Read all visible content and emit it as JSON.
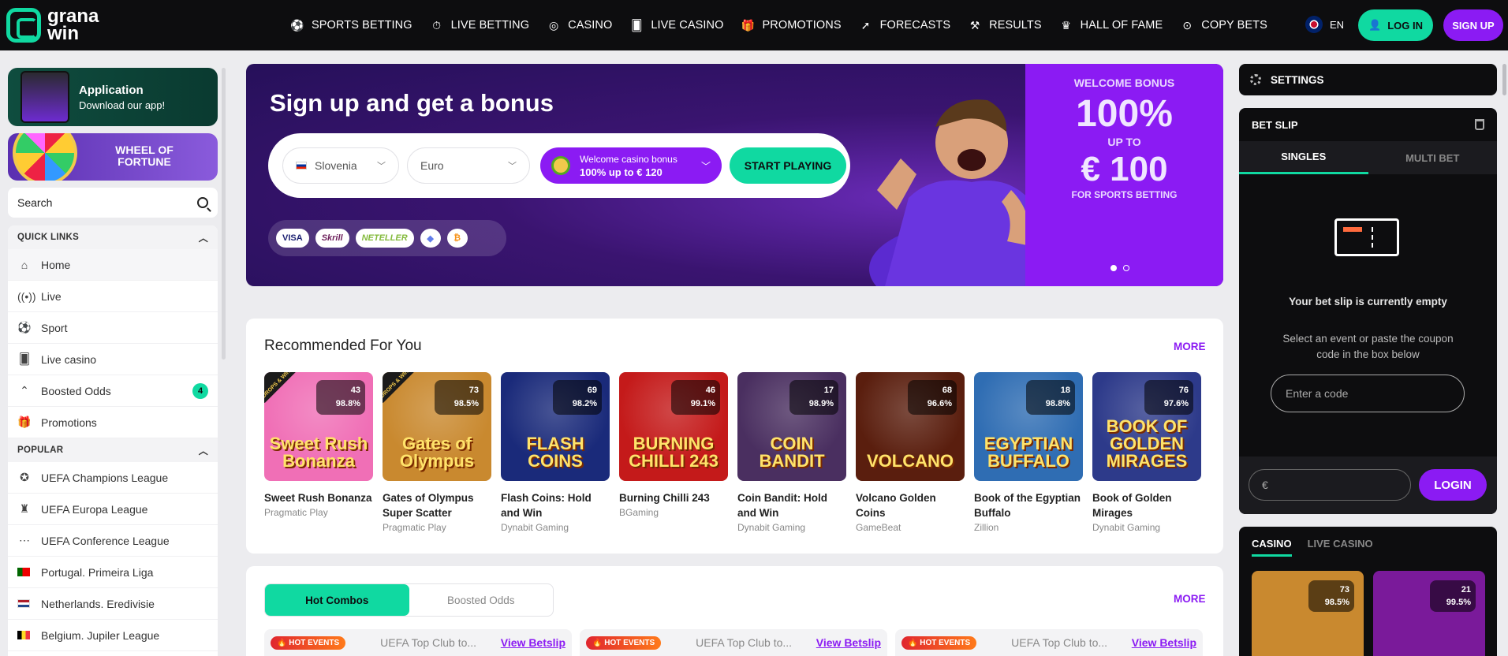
{
  "brand": {
    "line1": "grana",
    "line2": "win"
  },
  "nav": [
    {
      "label": "SPORTS BETTING",
      "icon": "soccer-ball-icon"
    },
    {
      "label": "LIVE BETTING",
      "icon": "stopwatch-icon"
    },
    {
      "label": "CASINO",
      "icon": "roulette-icon"
    },
    {
      "label": "LIVE CASINO",
      "icon": "cards-icon"
    },
    {
      "label": "PROMOTIONS",
      "icon": "gift-icon"
    },
    {
      "label": "FORECASTS",
      "icon": "pointer-icon"
    },
    {
      "label": "RESULTS",
      "icon": "tools-icon"
    },
    {
      "label": "HALL OF FAME",
      "icon": "trophy-icon"
    },
    {
      "label": "COPY BETS",
      "icon": "copy-icon"
    }
  ],
  "header": {
    "lang": "EN",
    "login": "LOG IN",
    "signup": "SIGN UP"
  },
  "sidebar": {
    "app_title": "Application",
    "app_sub": "Download our app!",
    "wheel": "WHEEL OF FORTUNE",
    "search_placeholder": "Search",
    "quick_links_title": "QUICK LINKS",
    "quick_links": [
      {
        "label": "Home",
        "icon": "home-icon"
      },
      {
        "label": "Live",
        "icon": "live-icon"
      },
      {
        "label": "Sport",
        "icon": "soccer-ball-icon"
      },
      {
        "label": "Live casino",
        "icon": "cards-icon"
      },
      {
        "label": "Boosted Odds",
        "icon": "boost-icon",
        "count": "4"
      },
      {
        "label": "Promotions",
        "icon": "gift-icon"
      }
    ],
    "popular_title": "POPULAR",
    "popular": [
      {
        "label": "UEFA Champions League",
        "icon": "ucl-icon"
      },
      {
        "label": "UEFA Europa League",
        "icon": "uel-icon"
      },
      {
        "label": "UEFA Conference League",
        "icon": "uecl-icon"
      },
      {
        "label": "Portugal. Primeira Liga",
        "icon": "flag-portugal-icon"
      },
      {
        "label": "Netherlands. Eredivisie",
        "icon": "flag-netherlands-icon"
      },
      {
        "label": "Belgium. Jupiler League",
        "icon": "flag-belgium-icon"
      }
    ]
  },
  "banner": {
    "title": "Sign up and get a bonus",
    "country": "Slovenia",
    "currency": "Euro",
    "bonus_line1": "Welcome casino bonus",
    "bonus_line2": "100% up to € 120",
    "cta": "START PLAYING",
    "payments": [
      "VISA",
      "Skrill",
      "NETELLER"
    ],
    "side": {
      "welcome": "WELCOME BONUS",
      "percent": "100%",
      "upto": "UP TO",
      "amount": "€ 100",
      "for": "FOR SPORTS BETTING"
    }
  },
  "recommended": {
    "title": "Recommended For You",
    "more": "MORE",
    "games": [
      {
        "name": "Sweet Rush Bonanza",
        "provider": "Pragmatic Play",
        "players": "43",
        "rtp": "98.8%",
        "art": "Sweet Rush Bonanza",
        "bg": "#f06fb6",
        "drops": true
      },
      {
        "name": "Gates of Olympus Super Scatter",
        "provider": "Pragmatic Play",
        "players": "73",
        "rtp": "98.5%",
        "art": "Gates of Olympus",
        "bg": "#c9892f",
        "drops": true
      },
      {
        "name": "Flash Coins: Hold and Win",
        "provider": "Dynabit Gaming",
        "players": "69",
        "rtp": "98.2%",
        "art": "FLASH COINS",
        "bg": "#1a2a7a",
        "drops": false
      },
      {
        "name": "Burning Chilli 243",
        "provider": "BGaming",
        "players": "46",
        "rtp": "99.1%",
        "art": "BURNING CHILLI 243",
        "bg": "#c41a1a",
        "drops": false
      },
      {
        "name": "Coin Bandit: Hold and Win",
        "provider": "Dynabit Gaming",
        "players": "17",
        "rtp": "98.9%",
        "art": "COIN BANDIT",
        "bg": "#4a2f60",
        "drops": false
      },
      {
        "name": "Volcano Golden Coins",
        "provider": "GameBeat",
        "players": "68",
        "rtp": "96.6%",
        "art": "VOLCANO",
        "bg": "#5a1e0e",
        "drops": false
      },
      {
        "name": "Book of the Egyptian Buffalo",
        "provider": "Zillion",
        "players": "18",
        "rtp": "98.8%",
        "art": "EGYPTIAN BUFFALO",
        "bg": "#2f6db3",
        "drops": false
      },
      {
        "name": "Book of Golden Mirages",
        "provider": "Dynabit Gaming",
        "players": "76",
        "rtp": "97.6%",
        "art": "BOOK OF GOLDEN MIRAGES",
        "bg": "#2d3a8a",
        "drops": false
      }
    ]
  },
  "combos": {
    "tab_hot": "Hot Combos",
    "tab_boosted": "Boosted Odds",
    "more": "MORE",
    "cards": [
      {
        "badge": "HOT EVENTS",
        "name": "UEFA Top Club to...",
        "link": "View Betslip"
      },
      {
        "badge": "HOT EVENTS",
        "name": "UEFA Top Club to...",
        "link": "View Betslip"
      },
      {
        "badge": "HOT EVENTS",
        "name": "UEFA Top Club to...",
        "link": "View Betslip"
      }
    ]
  },
  "settings": {
    "label": "SETTINGS"
  },
  "betslip": {
    "title": "BET SLIP",
    "tab_singles": "SINGLES",
    "tab_multi": "MULTI BET",
    "empty": "Your bet slip is currently empty",
    "desc": "Select an event or paste the coupon code in the box below",
    "code_placeholder": "Enter a code",
    "amount_placeholder": "€",
    "login": "LOGIN"
  },
  "casino_panel": {
    "tab_casino": "CASINO",
    "tab_live": "LIVE CASINO",
    "games": [
      {
        "players": "73",
        "rtp": "98.5%",
        "bg": "#c9892f"
      },
      {
        "players": "21",
        "rtp": "99.5%",
        "bg": "#7a1a9a"
      }
    ]
  },
  "colors": {
    "accent_green": "#10d9a1",
    "accent_purple": "#8b1bf3",
    "header_bg": "#0d0d0f"
  }
}
